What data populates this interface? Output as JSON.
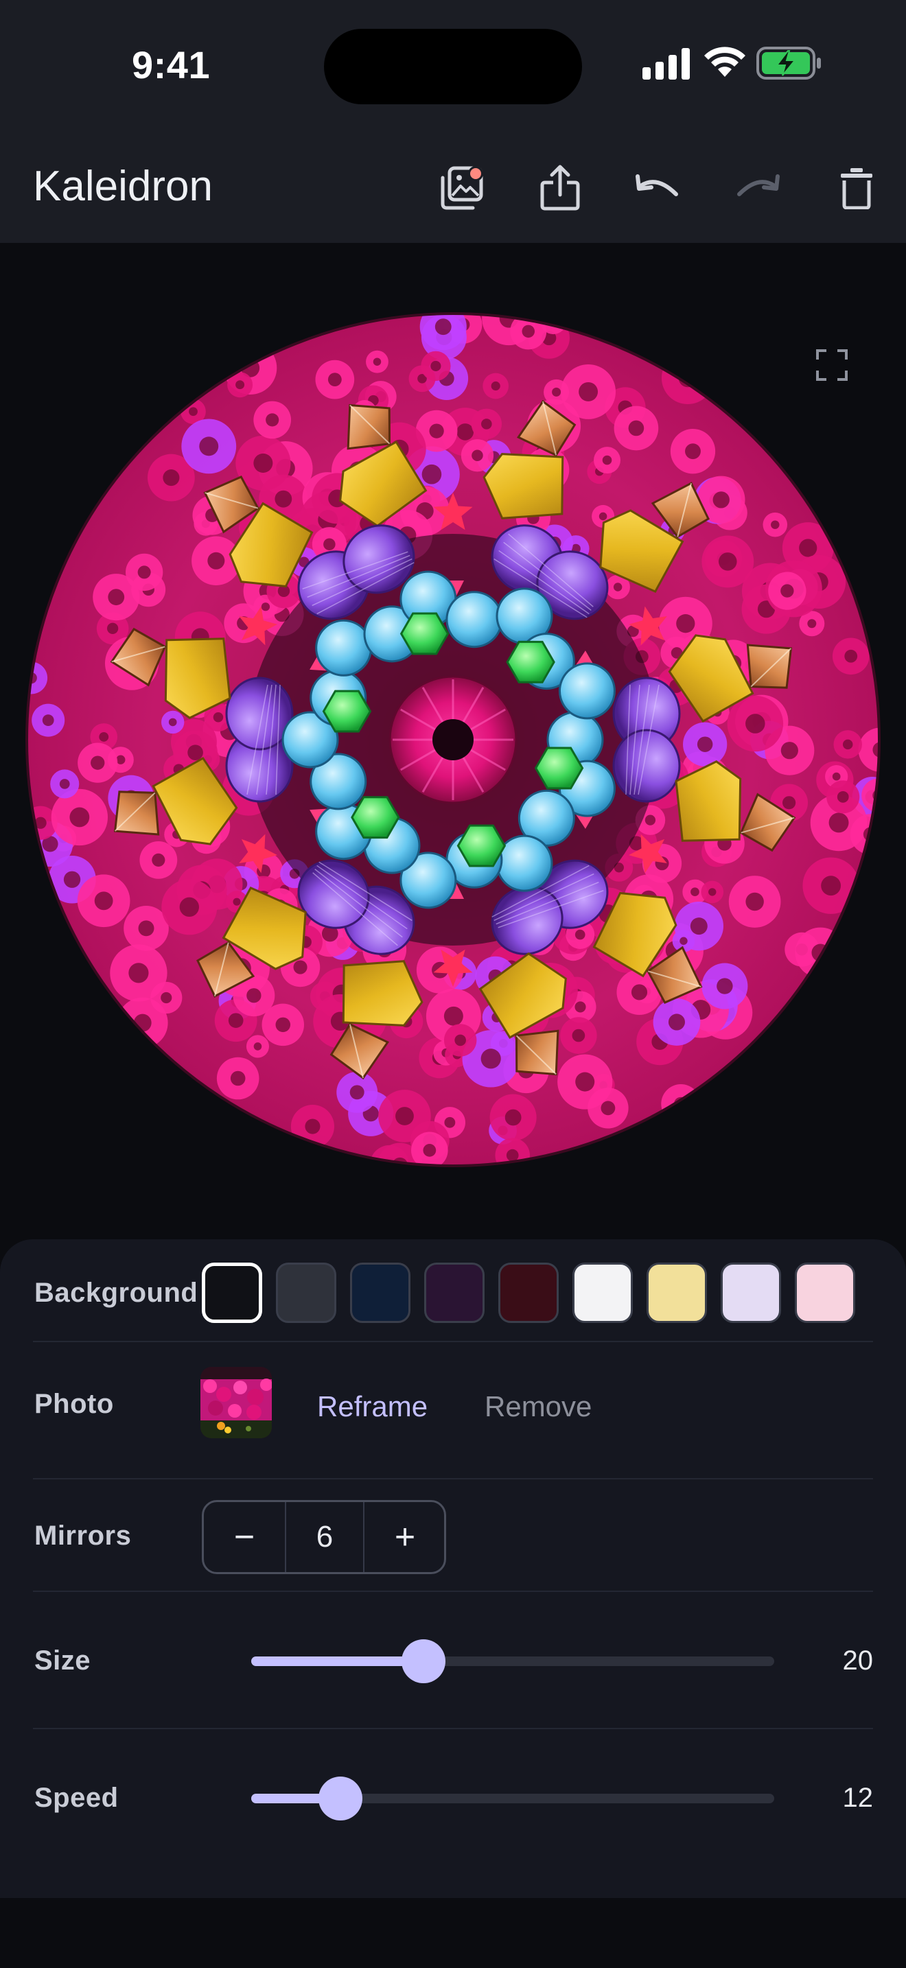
{
  "status_bar": {
    "time": "9:41",
    "icons": [
      "signal-icon",
      "wifi-icon",
      "battery-charging-icon"
    ]
  },
  "app_bar": {
    "title": "Kaleidron",
    "actions": [
      {
        "name": "gallery-button",
        "icon": "photo-gallery-icon",
        "badge": true
      },
      {
        "name": "share-button",
        "icon": "share-icon"
      },
      {
        "name": "undo-button",
        "icon": "undo-icon"
      },
      {
        "name": "redo-button",
        "icon": "redo-icon",
        "disabled": true
      },
      {
        "name": "delete-button",
        "icon": "trash-icon"
      }
    ]
  },
  "canvas": {
    "fullscreen_icon": "fullscreen-icon"
  },
  "controls": {
    "background": {
      "label": "Background",
      "swatches": [
        "#101116",
        "#2f323b",
        "#0f1f38",
        "#2a1433",
        "#3a0d17",
        "#f3f3f5",
        "#f2e09a",
        "#e4dcf4",
        "#f8d3df"
      ],
      "selected_index": 0
    },
    "photo": {
      "label": "Photo",
      "reframe_label": "Reframe",
      "remove_label": "Remove"
    },
    "mirrors": {
      "label": "Mirrors",
      "decrement_label": "−",
      "value": "6",
      "increment_label": "+"
    },
    "size": {
      "label": "Size",
      "value": "20",
      "fraction": 0.33
    },
    "speed": {
      "label": "Speed",
      "value": "12",
      "fraction": 0.17
    }
  },
  "colors": {
    "accent": "#c4c0ff",
    "panel": "#151720",
    "header": "#1b1d24"
  }
}
